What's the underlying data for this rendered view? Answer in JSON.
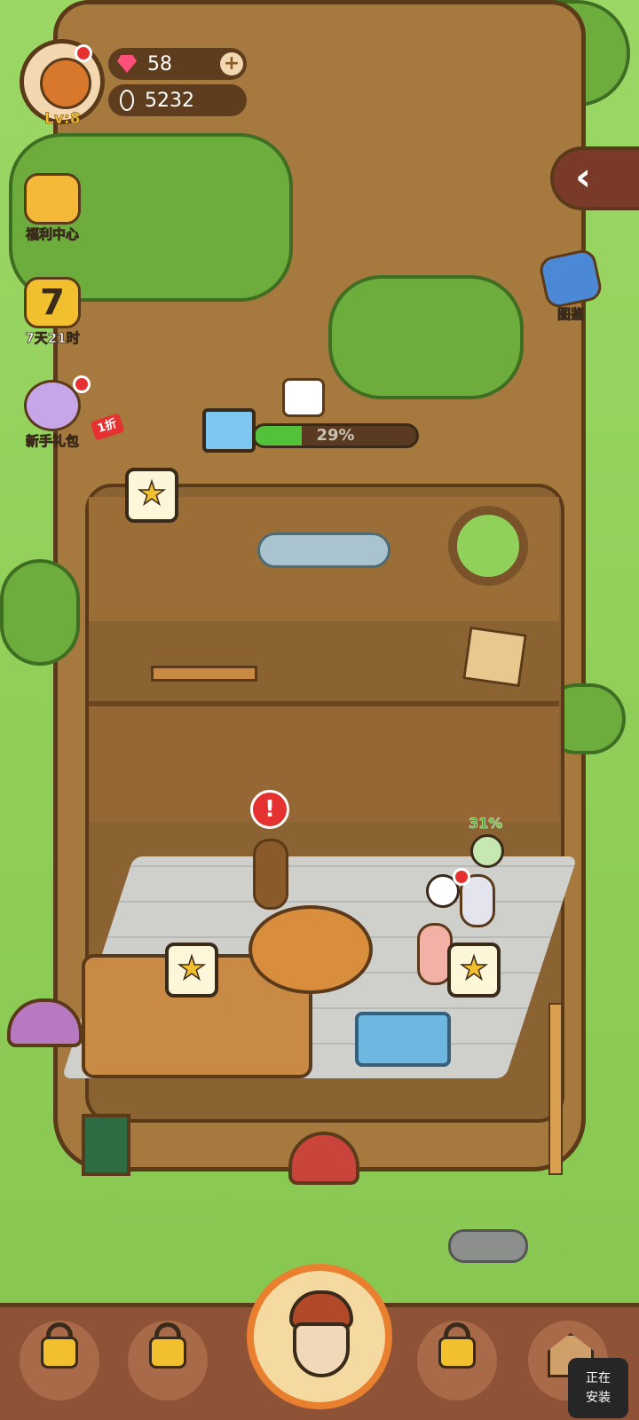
{
  "hud": {
    "level": "Lv:8",
    "gems": "58",
    "seeds": "5232",
    "add_symbol": "+"
  },
  "side_menu": {
    "welfare": "福利中心",
    "seven_day": "7天21时",
    "seven_day_big": "7",
    "newbie_pack": "新手礼包",
    "sale_tag": "1折",
    "collection": "图鉴"
  },
  "shop": {
    "progress_label": "29%",
    "progress_value": 0.29
  },
  "scene": {
    "star_symbol": "★",
    "alert_symbol": "!",
    "customer_percent": "31%"
  },
  "back_symbol": "‹",
  "status": {
    "installing_line1": "正在",
    "installing_line2": "安装"
  },
  "colors": {
    "grass": "#8fcf5a",
    "trunk": "#a6793f",
    "progress": "#53c23a",
    "bottom_bar": "#8e5337",
    "alert": "#e63131"
  }
}
